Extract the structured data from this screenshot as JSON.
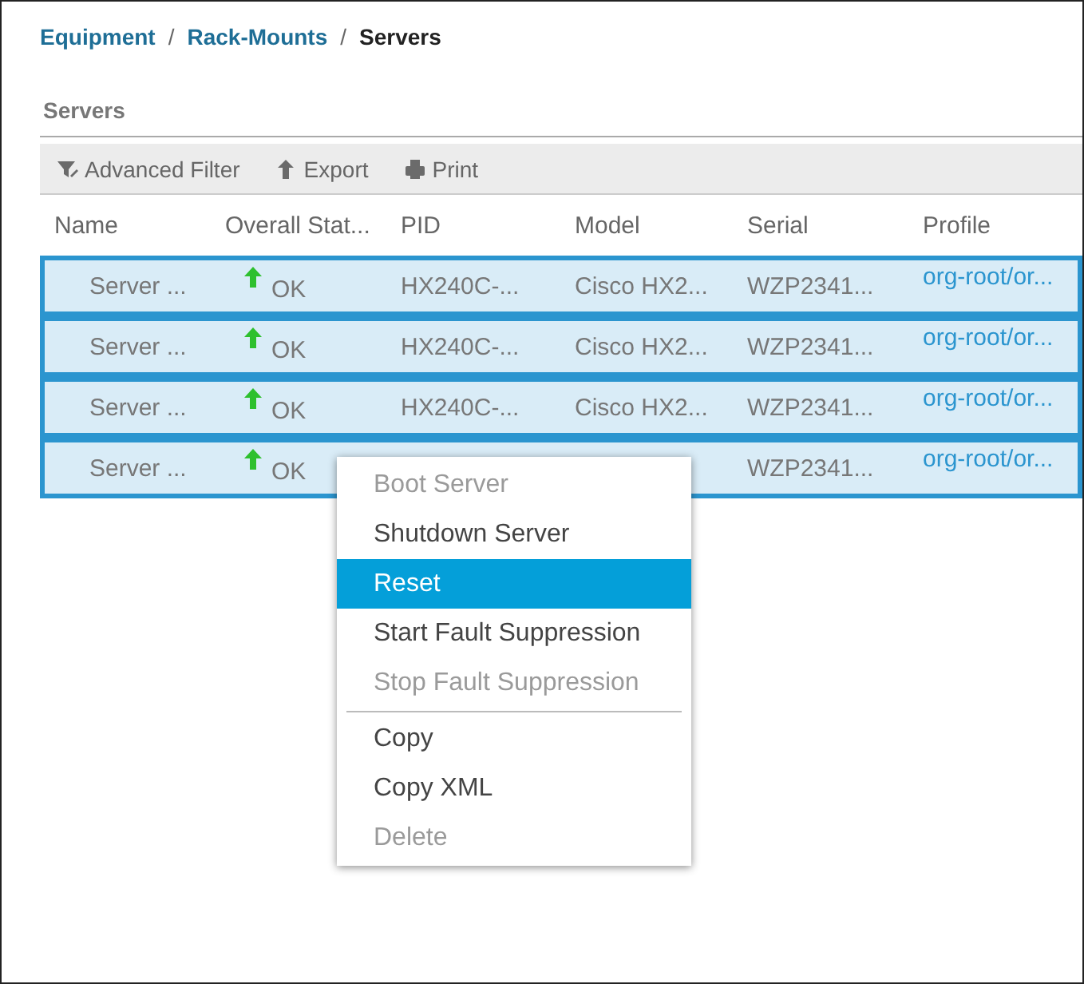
{
  "breadcrumb": [
    {
      "label": "Equipment",
      "link": true,
      "separator": "/"
    },
    {
      "label": "Rack-Mounts",
      "link": true,
      "separator": "/"
    },
    {
      "label": "Servers",
      "link": false
    }
  ],
  "panel": {
    "title": "Servers"
  },
  "toolbar": [
    {
      "label": "Advanced Filter",
      "kind": "filter"
    },
    {
      "label": "Export",
      "kind": "export"
    },
    {
      "label": "Print",
      "kind": "print"
    }
  ],
  "table": {
    "columns": [
      "Name",
      "Overall Stat...",
      "PID",
      "Model",
      "Serial",
      "Profile"
    ],
    "rows": [
      {
        "selected": true,
        "name": "Server ...",
        "status": "OK",
        "pid": "HX240C-...",
        "model": "Cisco HX2...",
        "serial": "WZP2341...",
        "profile": "org-root/or..."
      },
      {
        "selected": true,
        "name": "Server ...",
        "status": "OK",
        "pid": "HX240C-...",
        "model": "Cisco HX2...",
        "serial": "WZP2341...",
        "profile": "org-root/or..."
      },
      {
        "selected": true,
        "name": "Server ...",
        "status": "OK",
        "pid": "HX240C-...",
        "model": "Cisco HX2...",
        "serial": "WZP2341...",
        "profile": "org-root/or..."
      },
      {
        "selected": true,
        "name": "Server ...",
        "status": "OK",
        "serial": "WZP2341...",
        "profile": "org-root/or..."
      }
    ]
  },
  "context_menu": {
    "groups": [
      [
        {
          "label": "Boot Server",
          "disabled": true,
          "selected": false
        },
        {
          "label": "Shutdown Server",
          "disabled": false,
          "selected": false
        },
        {
          "label": "Reset",
          "disabled": false,
          "selected": true
        },
        {
          "label": "Start Fault Suppression",
          "disabled": false,
          "selected": false
        },
        {
          "label": "Stop Fault Suppression",
          "disabled": true,
          "selected": false
        }
      ],
      [
        {
          "label": "Copy",
          "disabled": false,
          "selected": false
        },
        {
          "label": "Copy XML",
          "disabled": false,
          "selected": false
        },
        {
          "label": "Delete",
          "disabled": true,
          "selected": false
        }
      ]
    ]
  }
}
